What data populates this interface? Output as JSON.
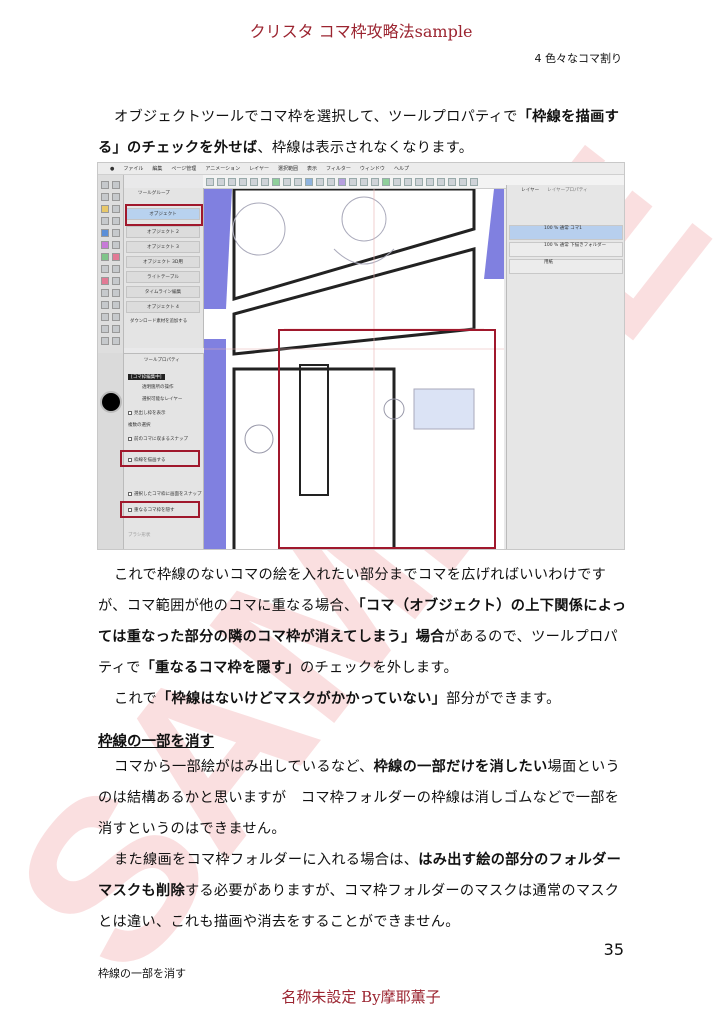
{
  "header": {
    "book_title": "クリスタ コマ枠攻略法sample",
    "chapter_label": "4 色々なコマ割り"
  },
  "paragraph1": {
    "text_a": "オブジェクトツールでコマ枠を選択して、ツールプロパティで",
    "bold_a": "「枠線を描画する」のチェックを外せば",
    "text_b": "、枠線は表示されなくなります。"
  },
  "screenshot": {
    "menu_items": [
      "ファイル",
      "編集",
      "ページ管理",
      "アニメーション",
      "レイヤー",
      "選択範囲",
      "表示",
      "フィルター",
      "ウィンドウ",
      "ヘルプ"
    ],
    "subtool_header": "ツールグループ",
    "subtool_items": [
      "オブジェクト",
      "オブジェクト 2",
      "オブジェクト 3",
      "オブジェクト 3D用",
      "ライトテーブル",
      "タイムライン編集",
      "オブジェクト 4"
    ],
    "download_label": "ダウンロード素材を追加する",
    "toolprop_header": "ツールプロパティ",
    "toolprop_rows": [
      "[コマ枠編集中]",
      "透明箇所の操作",
      "選択可能なレイヤー",
      "見出し枠を表示",
      "複数の選択",
      "前のコマに収まるスナップ",
      "枠線を描画する",
      "選択したコマ枠に画面をスナップ",
      "重なるコマ枠を隠す",
      "ブラシ形状"
    ],
    "layer_tabs": [
      "レイヤー",
      "レイヤープロパティ"
    ],
    "layer_rows": [
      "100 % 通常 コマ1",
      "100 % 通常 下描きフォルダー",
      "用紙"
    ]
  },
  "paragraph2": {
    "text_a": "これで枠線のないコマの絵を入れたい部分までコマを広げればいいわけですが、コマ範囲が他のコマに重なる場合、",
    "bold_a": "「コマ（オブジェクト）の上下関係によっては重なった部分の隣のコマ枠が消えてしまう」場合",
    "text_b": "があるので、ツールプロパティで",
    "bold_b": "「重なるコマ枠を隠す」",
    "text_c": "のチェックを外します。"
  },
  "paragraph3": {
    "text_a": "これで",
    "bold_a": "「枠線はないけどマスクがかかっていない」",
    "text_b": "部分ができます。"
  },
  "section": {
    "heading": "枠線の一部を消す"
  },
  "paragraph4": {
    "text_a": "コマから一部絵がはみ出しているなど、",
    "bold_a": "枠線の一部だけを消したい",
    "text_b": "場面というのは結構あるかと思いますが　コマ枠フォルダーの枠線は消しゴムなどで一部を消すというのはできません。"
  },
  "paragraph5": {
    "text_a": "また線画をコマ枠フォルダーに入れる場合は、",
    "bold_a": "はみ出す絵の部分のフォルダーマスクも削除",
    "text_b": "する必要がありますが、コマ枠フォルダーのマスクは通常のマスクとは違い、これも描画や消去をすることができません。"
  },
  "footer": {
    "page_number": "35",
    "section_label": "枠線の一部を消す",
    "author_line": "名称未設定 By摩耶薫子"
  },
  "watermark": {
    "text": "SAMPLE",
    "color": "#f7c9cc"
  },
  "colors": {
    "accent": "#9b2430",
    "highlight_box": "#a0182c",
    "panel_blue": "#8080e0"
  }
}
